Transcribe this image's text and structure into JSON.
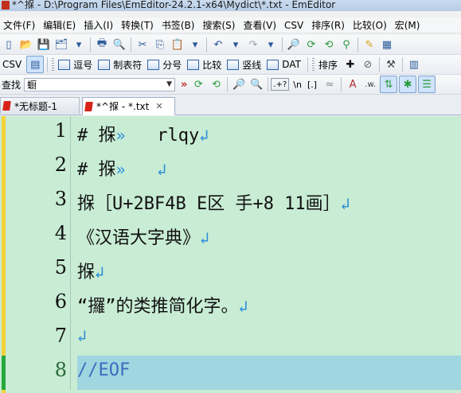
{
  "window": {
    "title": "*^㨐 - D:\\Program Files\\EmEditor-24.2.1-x64\\Mydict\\*.txt - EmEditor"
  },
  "menu": [
    "文件(F)",
    "编辑(E)",
    "插入(I)",
    "转换(T)",
    "书签(B)",
    "搜索(S)",
    "查看(V)",
    "CSV",
    "排序(R)",
    "比较(O)",
    "宏(M)"
  ],
  "csv_toolbar": {
    "csv_label": "CSV",
    "buttons": [
      "逗号",
      "制表符",
      "分号",
      "比较",
      "竖线",
      "DAT"
    ],
    "sort_label": "排序"
  },
  "find_toolbar": {
    "label": "查找",
    "value": "蟵",
    "regex_label": ".+?",
    "newline_label": "\\n",
    "brackets_label": "[.]"
  },
  "tabs": [
    {
      "label": "*无标题-1",
      "active": false
    },
    {
      "label": "*^㨐 - *.txt",
      "active": true
    }
  ],
  "editor": {
    "lines": [
      {
        "num": "1",
        "text": "# 㨐",
        "mark": "»",
        "after": "   rlqy",
        "ret": "↲"
      },
      {
        "num": "2",
        "text": "# 㨐",
        "mark": "»",
        "after": "   ",
        "ret": "↲"
      },
      {
        "num": "3",
        "text": "㨐［U+2BF4B E区 手+8 11画］",
        "mark": "",
        "after": "",
        "ret": "↲"
      },
      {
        "num": "4",
        "text": "《汉语大字典》",
        "mark": "",
        "after": "",
        "ret": "↲"
      },
      {
        "num": "5",
        "text": "㨐",
        "mark": "",
        "after": "",
        "ret": "↲"
      },
      {
        "num": "6",
        "text": "“攞”的类推简化字。",
        "mark": "",
        "after": "",
        "ret": "↲"
      },
      {
        "num": "7",
        "text": "",
        "mark": "",
        "after": "",
        "ret": "↲"
      },
      {
        "num": "8",
        "text": "//EOF",
        "mark": "",
        "after": "",
        "ret": ""
      }
    ]
  },
  "colors": {
    "editor_bg": "#c8ecd4",
    "current_line_bg": "#9fd6df",
    "modified_bar": "#f3d23a",
    "saved_bar": "#27a83e",
    "mark_blue": "#2e8fd8"
  }
}
